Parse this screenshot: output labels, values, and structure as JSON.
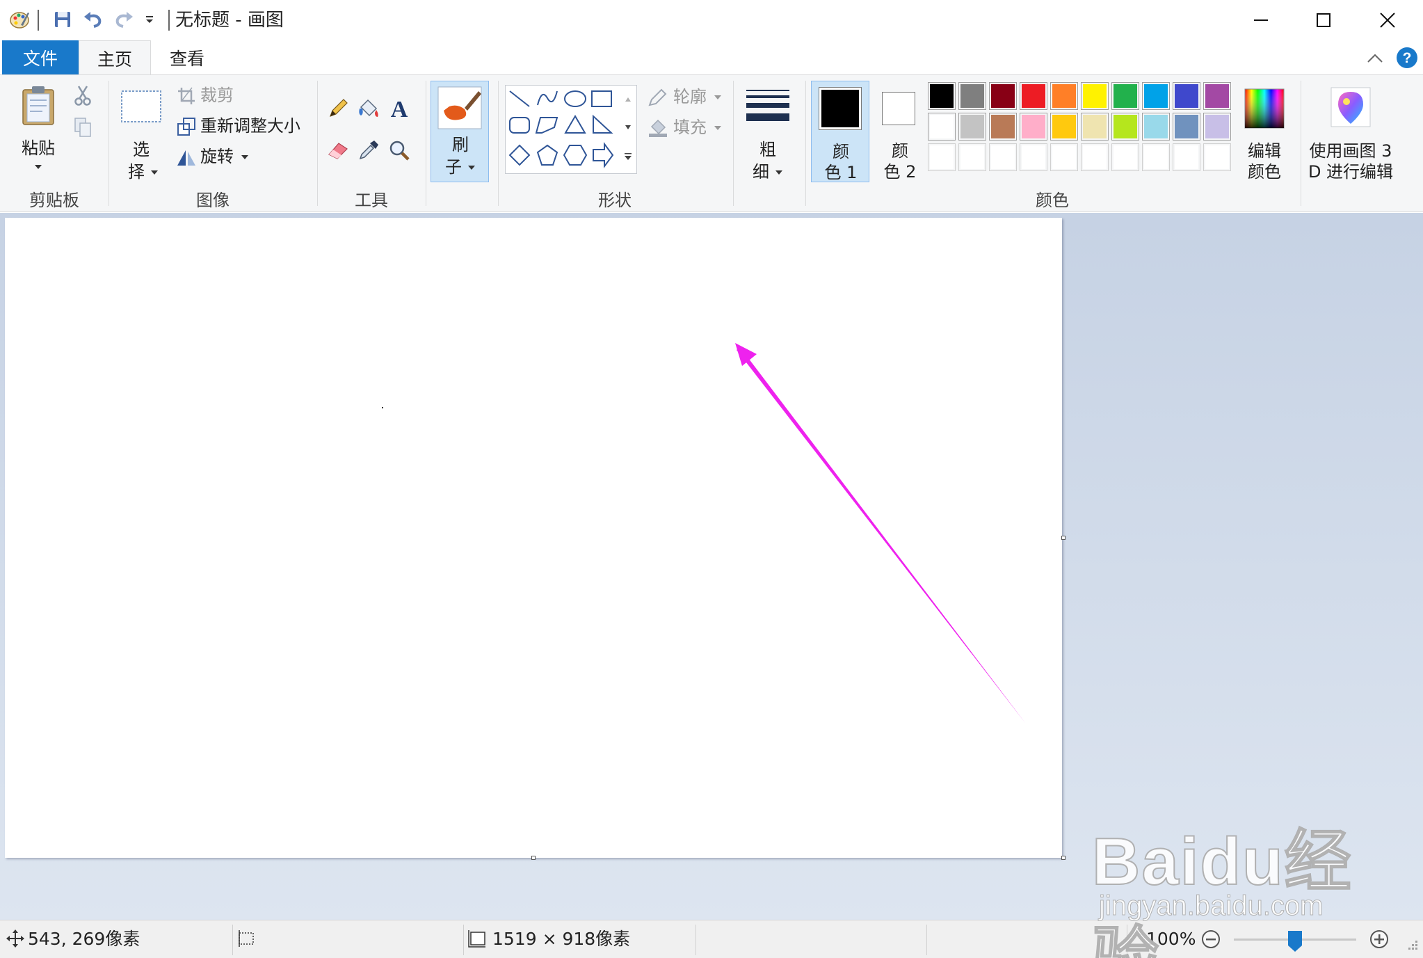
{
  "window": {
    "title": "无标题 - 画图"
  },
  "tabs": [
    {
      "label": "文件"
    },
    {
      "label": "主页"
    },
    {
      "label": "查看"
    }
  ],
  "clipboard": {
    "paste_label_line1": "粘贴",
    "group_label": "剪贴板"
  },
  "image": {
    "select_line1": "选",
    "select_line2": "择",
    "crop": "裁剪",
    "resize": "重新调整大小",
    "rotate": "旋转",
    "group_label": "图像"
  },
  "tools": {
    "group_label": "工具"
  },
  "brushes": {
    "line1": "刷",
    "line2": "子"
  },
  "shapes": {
    "outline": "轮廓",
    "fill": "填充",
    "group_label": "形状"
  },
  "size": {
    "line1": "粗",
    "line2": "细"
  },
  "colors": {
    "color1_line1": "颜",
    "color1_line2": "色 1",
    "color2_line1": "颜",
    "color2_line2": "色 2",
    "edit_line1": "编辑",
    "edit_line2": "颜色",
    "group_label": "颜色",
    "color1_value": "#000000",
    "color2_value": "#ffffff",
    "palette_row1": [
      "#000000",
      "#7f7f7f",
      "#880015",
      "#ed1c24",
      "#ff7f27",
      "#fff200",
      "#22b14c",
      "#00a2e8",
      "#3f48cc",
      "#a349a4"
    ],
    "palette_row2": [
      "#ffffff",
      "#c3c3c3",
      "#b97a57",
      "#ffaec9",
      "#ffc90e",
      "#efe4b0",
      "#b5e61d",
      "#99d9ea",
      "#7092be",
      "#c8bfe7"
    ],
    "palette_row3": [
      "#ffffff",
      "#ffffff",
      "#ffffff",
      "#ffffff",
      "#ffffff",
      "#ffffff",
      "#ffffff",
      "#ffffff",
      "#ffffff",
      "#ffffff"
    ]
  },
  "paint3d": {
    "line1": "使用画图 3",
    "line2": "D 进行编辑"
  },
  "annotation": {
    "arrow_color": "#ee22ee"
  },
  "status": {
    "cursor_position": "543, 269像素",
    "canvas_size": "1519 × 918像素",
    "zoom": "100%",
    "zoom_fraction": 0.5
  },
  "watermark": {
    "brand": "Baidu经验",
    "url": "jingyan.baidu.com"
  }
}
